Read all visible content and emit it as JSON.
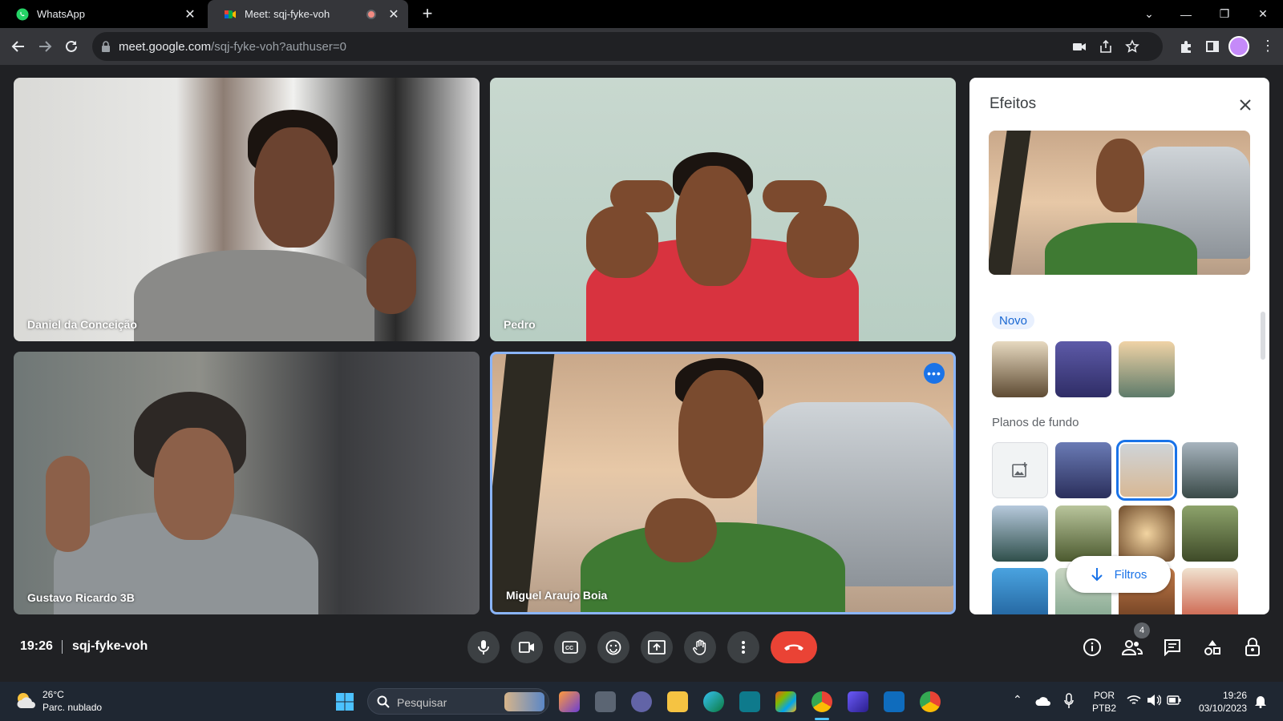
{
  "browser": {
    "tabs": [
      {
        "label": "WhatsApp"
      },
      {
        "label": "Meet: sqj-fyke-voh"
      }
    ],
    "url_host": "meet.google.com",
    "url_path": "/sqj-fyke-voh?authuser=0"
  },
  "participants": [
    {
      "name": "Daniel da Conceição"
    },
    {
      "name": "Pedro"
    },
    {
      "name": "Gustavo Ricardo 3B"
    },
    {
      "name": "Miguel Araujo Boia"
    }
  ],
  "effects_panel": {
    "title": "Efeitos",
    "new_chip": "Novo",
    "backgrounds_heading": "Planos de fundo",
    "filters_button": "Filtros"
  },
  "meeting_bar": {
    "time": "19:26",
    "code": "sqj-fyke-voh",
    "people_count": "4"
  },
  "taskbar": {
    "weather_temp": "26°C",
    "weather_desc": "Parc. nublado",
    "search_placeholder": "Pesquisar",
    "lang_1": "POR",
    "lang_2": "PTB2",
    "clock_time": "19:26",
    "clock_date": "03/10/2023"
  },
  "colors": {
    "accent": "#1a73e8",
    "hangup": "#ea4335",
    "selected_tile_border": "#8ab4f8",
    "meet_background": "#202124"
  }
}
